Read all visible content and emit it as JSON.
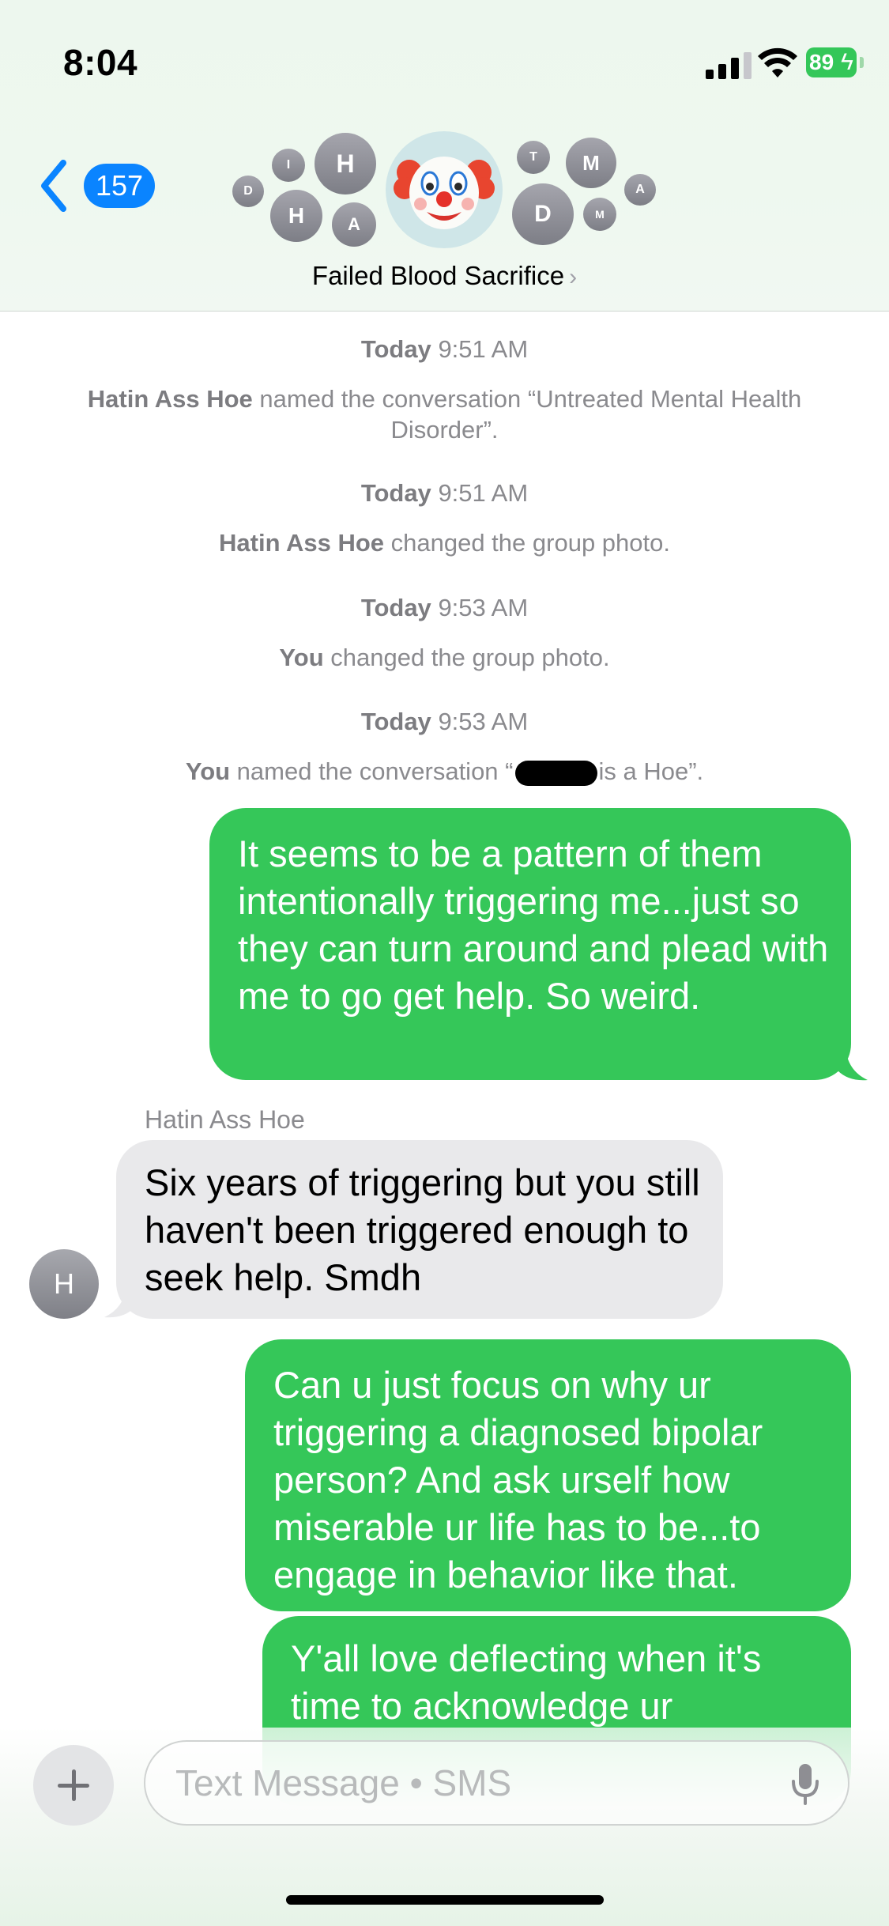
{
  "status_bar": {
    "time": "8:04",
    "battery": "89"
  },
  "header": {
    "back_count": "157",
    "group_name": "Failed Blood Sacrifice",
    "group_avatar_emoji": "🤡",
    "member_initials": [
      "D",
      "I",
      "H",
      "H",
      "A",
      "T",
      "M",
      "D",
      "M",
      "A"
    ]
  },
  "events": [
    {
      "day": "Today",
      "time": "9:51 AM",
      "actor": "Hatin Ass Hoe",
      "text": " named the conversation “Untreated Mental Health Disorder”."
    },
    {
      "day": "Today",
      "time": "9:51 AM",
      "actor": "Hatin Ass Hoe",
      "text": " changed the group photo."
    },
    {
      "day": "Today",
      "time": "9:53 AM",
      "actor": "You",
      "text": " changed the group photo."
    },
    {
      "day": "Today",
      "time": "9:53 AM",
      "actor": "You",
      "text_before": " named the conversation “",
      "text_after": "is a Hoe”."
    }
  ],
  "messages": [
    {
      "from": "me",
      "text": "It seems to be a pattern of them intentionally triggering me...just so they can turn around and plead with me to go get help. So weird."
    },
    {
      "from": "Hatin Ass Hoe",
      "sender_label": "Hatin Ass Hoe",
      "avatar_initial": "H",
      "text": "Six years of triggering but you still haven't been triggered enough to seek help. Smdh"
    },
    {
      "from": "me",
      "text": "Can u just focus on why ur triggering a diagnosed bipolar person? And ask urself how miserable ur life has to be...to engage in behavior like that."
    },
    {
      "from": "me",
      "text": "Y'all love deflecting when it's time to acknowledge ur"
    }
  ],
  "compose": {
    "placeholder": "Text Message • SMS"
  },
  "colors": {
    "outgoing_bubble": "#35c759",
    "incoming_bubble": "#e9e9eb",
    "accent": "#0a84ff"
  }
}
